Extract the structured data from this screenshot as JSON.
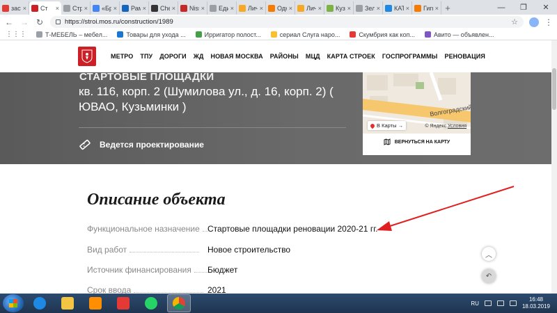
{
  "browser": {
    "tabs": [
      {
        "label": "застр",
        "color": "#e53935"
      },
      {
        "label": "Ст",
        "color": "#cc1f26",
        "active": true
      },
      {
        "label": "Страте",
        "color": "#9aa0a6"
      },
      {
        "label": "«Брате",
        "color": "#4285f4"
      },
      {
        "label": "Рамбл",
        "color": "#1565c0"
      },
      {
        "label": "Chevro",
        "color": "#333333"
      },
      {
        "label": "Nissan",
        "color": "#c62828"
      },
      {
        "label": "Едины",
        "color": "#9aa0a6"
      },
      {
        "label": "Личны",
        "color": "#f9a825"
      },
      {
        "label": "Однок",
        "color": "#f57c00"
      },
      {
        "label": "Личны",
        "color": "#f9a825"
      },
      {
        "label": "Кузьм",
        "color": "#7cb342"
      },
      {
        "label": "Зелен",
        "color": "#9aa0a6"
      },
      {
        "label": "КАТАЛ",
        "color": "#1e88e5"
      },
      {
        "label": "Гигие",
        "color": "#f57c00"
      }
    ],
    "url": "https://stroi.mos.ru/construction/1989",
    "bookmarks": [
      {
        "label": "Т-МЕБЕЛЬ – мебел...",
        "color": "#9aa0a6"
      },
      {
        "label": "Товары для ухода ...",
        "color": "#1976d2"
      },
      {
        "label": "Ирригатор полост...",
        "color": "#43a047"
      },
      {
        "label": "сериал Слуга наро...",
        "color": "#fbc02d"
      },
      {
        "label": "Скумбрия как коп...",
        "color": "#e53935"
      },
      {
        "label": "Авито — объявлен...",
        "color": "#7e57c2"
      }
    ]
  },
  "site": {
    "nav": [
      "МЕТРО",
      "ТПУ",
      "ДОРОГИ",
      "ЖД",
      "НОВАЯ МОСКВА",
      "РАЙОНЫ",
      "МЦД",
      "КАРТА СТРОЕК",
      "ГОСПРОГРАММЫ",
      "РЕНОВАЦИЯ"
    ]
  },
  "hero": {
    "subtitle": "СТАРТОВЫЕ ПЛОЩАДКИ",
    "title": "кв. 116, корп. 2 (Шумилова ул., д. 16, корп. 2) ( ЮВАО, Кузьминки )",
    "status": "Ведется проектирование"
  },
  "map": {
    "street": "Волгоградский",
    "open_btn": "В Карты →",
    "credit": "© Яндекс",
    "credit_link": "Условия",
    "back_label": "ВЕРНУТЬСЯ НА КАРТУ"
  },
  "description": {
    "title": "Описание объекта",
    "props": [
      {
        "key": "Функциональное назначение",
        "value": "Стартовые площадки реновации 2020-21 гг."
      },
      {
        "key": "Вид работ",
        "value": "Новое строительство"
      },
      {
        "key": "Источник финансирования",
        "value": "Бюджет"
      },
      {
        "key": "Срок ввода",
        "value": "2021"
      }
    ]
  },
  "taskbar": {
    "lang": "RU",
    "time": "16:48",
    "date": "18.03.2019"
  }
}
